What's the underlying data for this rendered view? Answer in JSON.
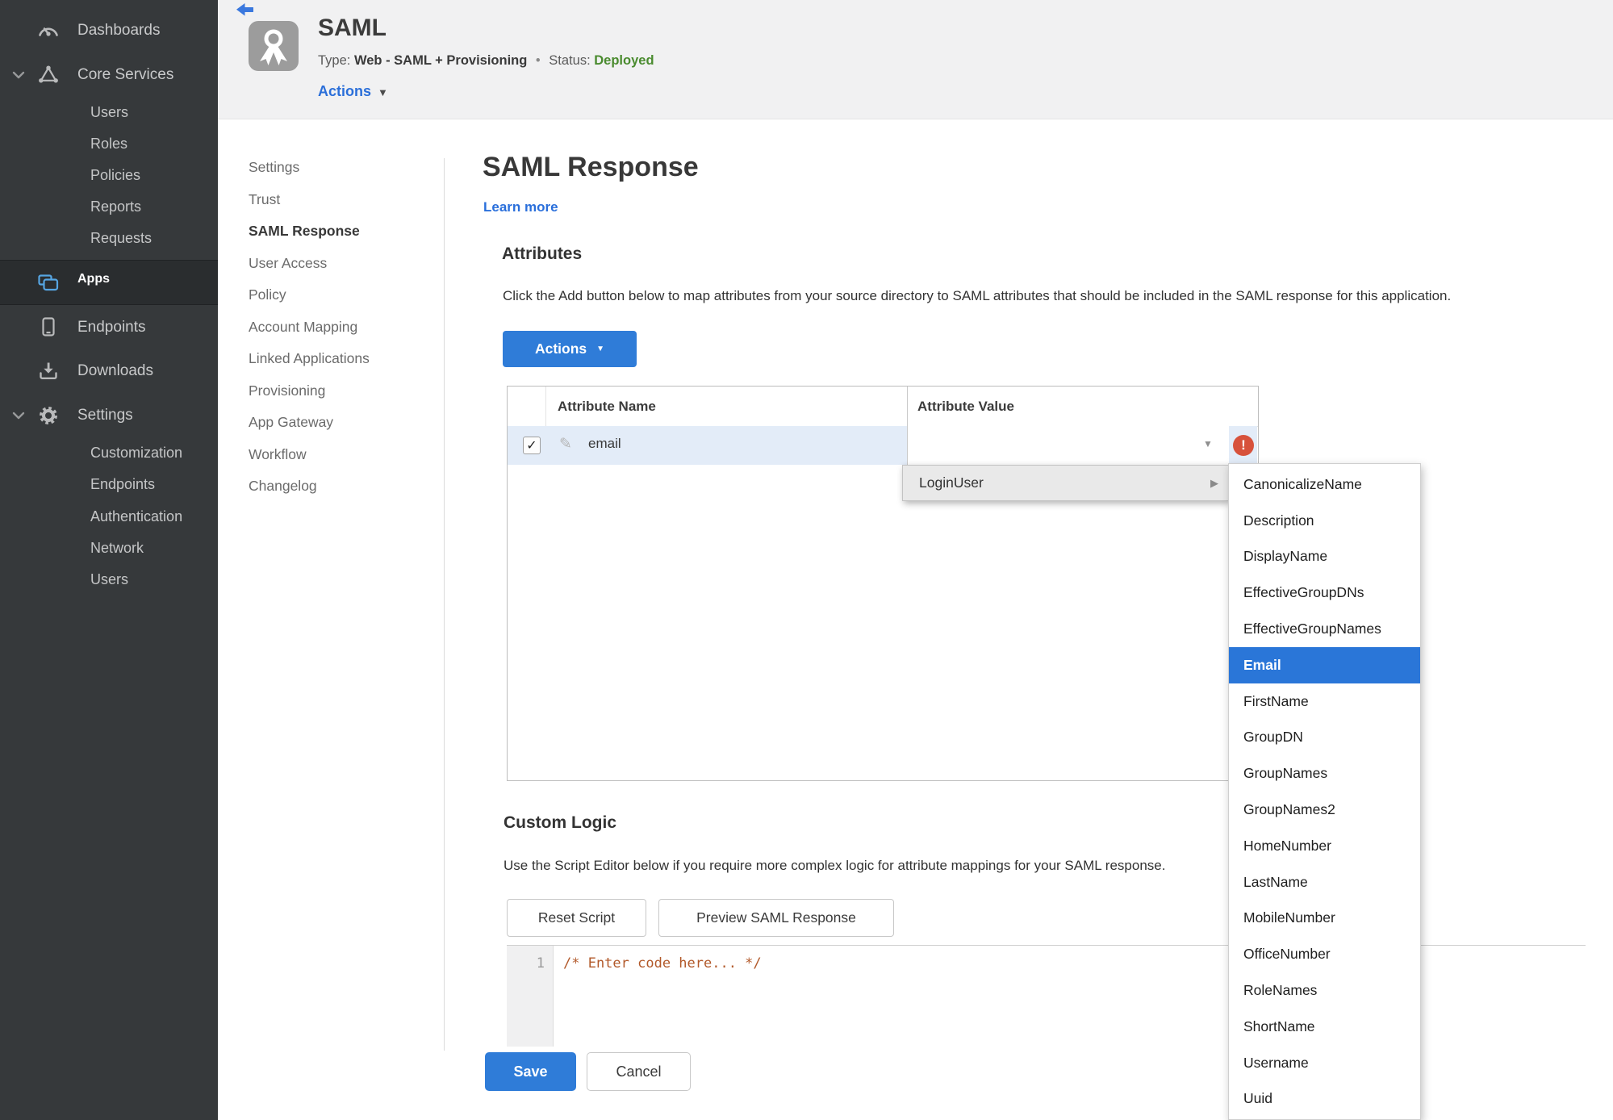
{
  "sidebar": {
    "dashboards": "Dashboards",
    "core_services": "Core Services",
    "core_children": [
      "Users",
      "Roles",
      "Policies",
      "Reports",
      "Requests"
    ],
    "apps": "Apps",
    "endpoints": "Endpoints",
    "downloads": "Downloads",
    "settings": "Settings",
    "settings_children": [
      "Customization",
      "Endpoints",
      "Authentication",
      "Network",
      "Users"
    ]
  },
  "header": {
    "title": "SAML",
    "type_label": "Type:",
    "type_value": "Web - SAML + Provisioning",
    "separator": "•",
    "status_label": "Status:",
    "status_value": "Deployed",
    "actions_label": "Actions"
  },
  "subnav": {
    "items": [
      "Settings",
      "Trust",
      "SAML Response",
      "User Access",
      "Policy",
      "Account Mapping",
      "Linked Applications",
      "Provisioning",
      "App Gateway",
      "Workflow",
      "Changelog"
    ],
    "active": "SAML Response"
  },
  "page": {
    "title": "SAML Response",
    "learn_more": "Learn more"
  },
  "attributes_section": {
    "heading": "Attributes",
    "description": "Click the Add button below to map attributes from your source directory to SAML attributes that should be included in the SAML response for this application.",
    "actions_button": "Actions",
    "columns": [
      "Attribute Name",
      "Attribute Value"
    ],
    "rows": [
      {
        "name": "email",
        "value": "",
        "checked": true,
        "error": true
      }
    ]
  },
  "attribute_menu": {
    "parent": "LoginUser",
    "options": [
      "CanonicalizeName",
      "Description",
      "DisplayName",
      "EffectiveGroupDNs",
      "EffectiveGroupNames",
      "Email",
      "FirstName",
      "GroupDN",
      "GroupNames",
      "GroupNames2",
      "HomeNumber",
      "LastName",
      "MobileNumber",
      "OfficeNumber",
      "RoleNames",
      "ShortName",
      "Username",
      "Uuid"
    ],
    "selected": "Email"
  },
  "custom_logic": {
    "heading": "Custom Logic",
    "description": "Use the Script Editor below if you require more complex logic for attribute mappings for your SAML response.",
    "reset_button": "Reset Script",
    "preview_button": "Preview SAML Response",
    "editor_line_number": "1",
    "editor_code": "/* Enter code here... */"
  },
  "footer": {
    "save_button": "Save",
    "cancel_button": "Cancel"
  },
  "glyphs": {
    "caret_down": "▼",
    "submenu_arrow": "▶",
    "pencil": "✎",
    "checkmark": "✓",
    "error_mark": "!"
  },
  "colors": {
    "accent_blue": "#2f7cd8",
    "selected_blue": "#2a76d8",
    "status_green": "#4a8b2f",
    "error_red": "#d7513b",
    "sidebar_bg": "#36393b",
    "sidebar_active_bg": "#2a2d2f",
    "header_bg": "#f1f1f2",
    "row_highlight": "#e3ecf8",
    "menu_bg": "#e9e9e9"
  }
}
